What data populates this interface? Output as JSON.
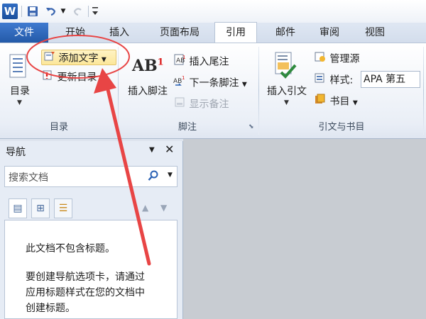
{
  "window": {
    "app_icon": "W",
    "quick_access": {
      "save_icon": "save-icon",
      "undo_icon": "undo-icon",
      "redo_icon": "redo-icon",
      "customize_icon": "customize-icon"
    }
  },
  "tabs": [
    {
      "label": "文件",
      "active": false
    },
    {
      "label": "开始",
      "active": false
    },
    {
      "label": "插入",
      "active": false
    },
    {
      "label": "页面布局",
      "active": false
    },
    {
      "label": "引用",
      "active": true
    },
    {
      "label": "邮件",
      "active": false
    },
    {
      "label": "审阅",
      "active": false
    },
    {
      "label": "视图",
      "active": false
    }
  ],
  "ribbon": {
    "toc": {
      "group_label": "目录",
      "toc_button": "目录",
      "add_text_button": "添加文字",
      "update_toc_button": "更新目录"
    },
    "footnotes": {
      "group_label": "脚注",
      "insert_footnote_button": "插入脚注",
      "ab_icon_text": "AB",
      "ab_superscript": "1",
      "insert_endnote_button": "插入尾注",
      "next_footnote_button": "下一条脚注",
      "show_notes_button": "显示备注"
    },
    "citations": {
      "group_label": "引文与书目",
      "insert_citation_button": "插入引文",
      "manage_sources_button": "管理源",
      "style_label": "样式:",
      "style_value": "APA 第五",
      "bibliography_button": "书目"
    }
  },
  "navigation_pane": {
    "title": "导航",
    "search_placeholder": "搜索文档",
    "message_line1": "此文档不包含标题。",
    "message_line2_a": "要创建导航选项卡，请通过",
    "message_line2_b": "应用标题样式在您的文档中",
    "message_line2_c": "创建标题。"
  },
  "annotation": {
    "color": "#e84545"
  },
  "colors": {
    "accent": "#2b62b5",
    "highlight": "#fce79a"
  }
}
